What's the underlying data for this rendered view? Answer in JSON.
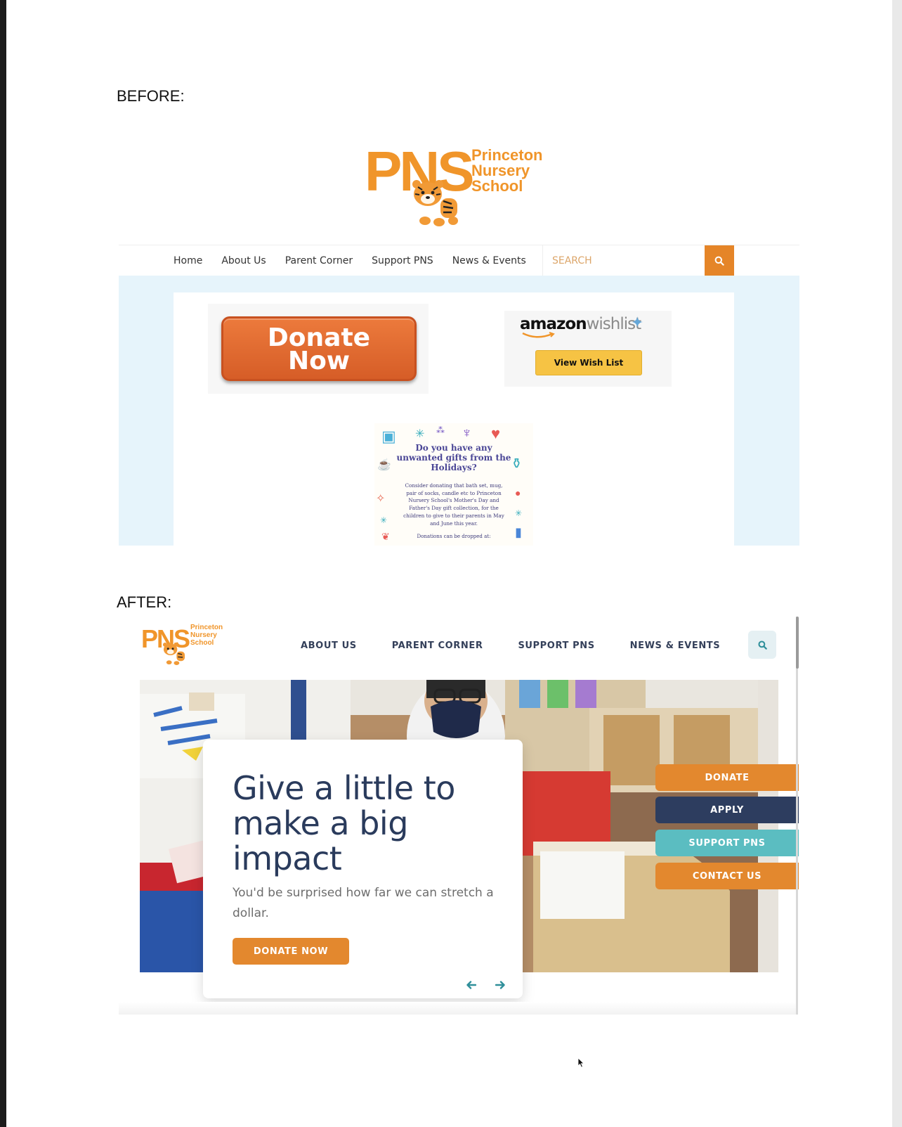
{
  "labels": {
    "before": "BEFORE:",
    "after": "AFTER:"
  },
  "before": {
    "logo": {
      "letters": "PNS",
      "name_line1": "Princeton",
      "name_line2": "Nursery",
      "name_line3": "School"
    },
    "nav": [
      "Home",
      "About Us",
      "Parent Corner",
      "Support PNS",
      "News & Events"
    ],
    "search": {
      "placeholder": "SEARCH",
      "icon": "search-icon"
    },
    "donate_button": {
      "line1": "Donate",
      "line2": "Now"
    },
    "wishlist": {
      "brand": "amazon",
      "suffix": "wishlist",
      "button": "View Wish List"
    },
    "flyer": {
      "title": "Do you have any unwanted gifts from the Holidays?",
      "body": "Consider donating that bath set, mug, pair of socks, candle etc to Princeton Nursery School's Mother's Day and Father's Day gift collection, for the children to give to their parents in May and June this year.",
      "footer": "Donations can be dropped at:"
    },
    "colors": {
      "accent": "#e58528",
      "hero_bg": "#e6f4fb"
    }
  },
  "after": {
    "logo": {
      "letters": "PNS",
      "name_line1": "Princeton",
      "name_line2": "Nursery",
      "name_line3": "School"
    },
    "nav": [
      "ABOUT US",
      "PARENT CORNER",
      "SUPPORT PNS",
      "NEWS & EVENTS"
    ],
    "search_icon": "search-icon",
    "hero": {
      "headline": "Give a little to make a big impact",
      "subtext": "You'd be surprised how far we can stretch a dollar.",
      "cta": "DONATE NOW"
    },
    "side_buttons": [
      {
        "label": "DONATE",
        "color": "#e3882e"
      },
      {
        "label": "APPLY",
        "color": "#2d3d5f"
      },
      {
        "label": "SUPPORT PNS",
        "color": "#5bbdc1"
      },
      {
        "label": "CONTACT US",
        "color": "#e3882e"
      }
    ],
    "colors": {
      "navy": "#2a3b5c",
      "orange": "#e3882e",
      "teal": "#2f8f9a"
    }
  }
}
